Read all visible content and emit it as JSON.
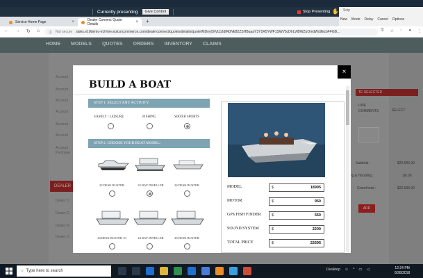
{
  "presenter": {
    "status": "Currently presenting",
    "give_control": "Give Control",
    "stop_label": "Stop Presenting"
  },
  "snip": {
    "title": "Snip",
    "new": "New",
    "mode": "Mode",
    "delay": "Delay",
    "cancel": "Cancel",
    "options": "Options"
  },
  "tabs": [
    {
      "label": "Service Home Page"
    },
    {
      "label": "Dealer Connect Quote Details"
    }
  ],
  "address": {
    "security": "Not secure",
    "url": "sales.e10demo-m2-live.epicorcommerce.com/dealerconnect/quotes/details/quote/MDoyOkVLb2dIR0NkB2ZSHBuaaY3Y1R5YWF1SWV5cDhLVlBWZuOmdWs9EzbFFGB..."
  },
  "app_nav": [
    "HOME",
    "MODELS",
    "QUOTES",
    "ORDERS",
    "INVENTORY",
    "CLAIMS"
  ],
  "background": {
    "links": [
      "Account",
      "Account",
      "Account",
      "Account",
      "Account",
      "Account",
      "Account Purchase"
    ],
    "dealer_button": "DEALER",
    "dealer_links": [
      "Dealer O",
      "Dealer C",
      "Dealer In",
      "Dealer C"
    ],
    "table_header": "TE SELECTED",
    "col_line": "LINE",
    "col_comments": "COMMENTS",
    "col_select": "SELECT",
    "qty": "0",
    "subtotal_label": "Subtotal :",
    "subtotal_value": "$22,695.00",
    "shipping_label": "ping & Handling :",
    "shipping_value": "$0.00",
    "grand_label": "Grand total :",
    "grand_value": "$22,695.00",
    "add_button": "ADD"
  },
  "modal": {
    "title": "BUILD A BOAT",
    "close": "×",
    "step1": "STEP 1. SELECT ANY ACTIVITY:",
    "step2": "STEP 2. CHOOSE YOUR BOAT MODEL:",
    "activities": [
      {
        "label": "FAMILY / LEISURE",
        "selected": false
      },
      {
        "label": "FISHING",
        "selected": false
      },
      {
        "label": "WATER SPORTS",
        "selected": true
      }
    ],
    "boats": [
      {
        "label": "22 DESK BUSTER",
        "selected": false
      },
      {
        "label": "22 BAY DWELLER",
        "selected": true
      },
      {
        "label": "24 DESK BUSTER",
        "selected": false
      },
      {
        "label": "24 DESK BUSTER 10",
        "selected": false
      },
      {
        "label": "24 BAY DWELLER",
        "selected": false
      },
      {
        "label": "26 DESK BUSTER",
        "selected": false
      }
    ],
    "summary": [
      {
        "label": "MODEL",
        "currency": "$",
        "value": "18995"
      },
      {
        "label": "MOTOR",
        "currency": "$",
        "value": "950"
      },
      {
        "label": "GPS FISH FINDER",
        "currency": "$",
        "value": "550"
      },
      {
        "label": "SOUND SYSTEM",
        "currency": "$",
        "value": "2200"
      },
      {
        "label": "TOTAL PRICE",
        "currency": "$",
        "value": "22695"
      }
    ]
  },
  "taskbar": {
    "search_placeholder": "Type here to search",
    "desktop": "Desktop",
    "time": "12:24 PM",
    "date": "9/28/2018"
  },
  "colors": {
    "step_bar": "#7ea3b3",
    "dealer_red": "#8b1e1e",
    "nav_bg": "#4d5d5d"
  }
}
